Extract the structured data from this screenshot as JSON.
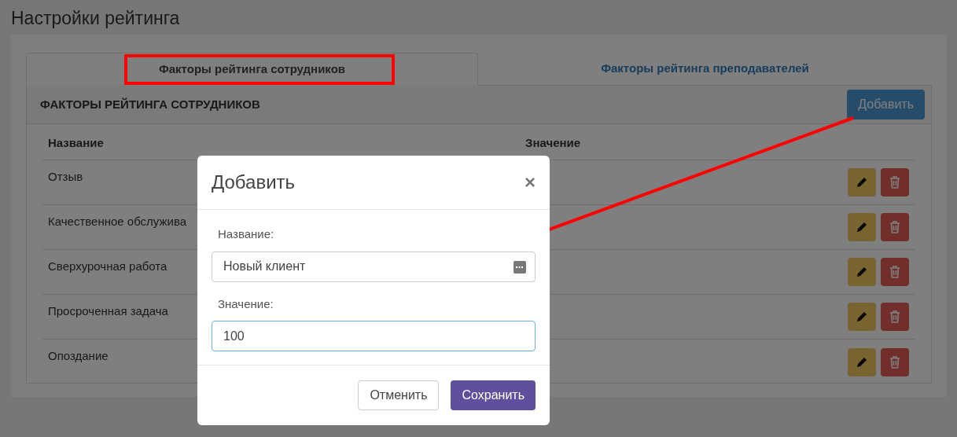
{
  "page_title": "Настройки рейтинга",
  "tabs": [
    {
      "label": "Факторы рейтинга сотрудников",
      "selected": true
    },
    {
      "label": "Факторы рейтинга преподавателей",
      "selected": false
    }
  ],
  "panel": {
    "title": "ФАКТОРЫ РЕЙТИНГА СОТРУДНИКОВ",
    "add_button": "Добавить"
  },
  "table": {
    "columns": [
      "Название",
      "Значение"
    ],
    "rows": [
      {
        "name": "Отзыв"
      },
      {
        "name": "Качественное обслужива"
      },
      {
        "name": "Сверхурочная работа"
      },
      {
        "name": "Просроченная задача"
      },
      {
        "name": "Опоздание"
      }
    ]
  },
  "modal": {
    "title": "Добавить",
    "close": "×",
    "fields": [
      {
        "label": "Название:",
        "value": "Новый клиент",
        "focused": false,
        "autofill": true
      },
      {
        "label": "Значение:",
        "value": "100",
        "focused": true,
        "autofill": false
      }
    ],
    "buttons": [
      {
        "label": "Отменить",
        "kind": "secondary"
      },
      {
        "label": "Сохранить",
        "kind": "primary"
      }
    ]
  }
}
